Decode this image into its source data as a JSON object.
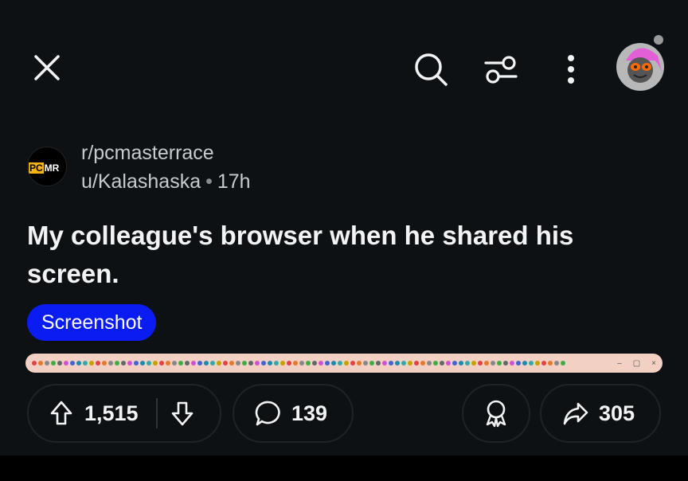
{
  "toolbar": {
    "close_icon": "close-icon",
    "search_icon": "search-icon",
    "filter_icon": "filter-sliders-icon",
    "more_icon": "more-vertical-icon",
    "avatar_icon": "user-avatar"
  },
  "post": {
    "subreddit": "r/pcmasterrace",
    "subreddit_logo_text_a": "PC",
    "subreddit_logo_text_b": "MR",
    "author": "u/Kalashaska",
    "age": "17h",
    "title": "My colleague's browser when he shared his screen.",
    "flair": "Screenshot",
    "flair_color": "#0a1cf2"
  },
  "actions": {
    "upvotes": "1,515",
    "comments": "139",
    "shares": "305"
  },
  "colors": {
    "background": "#0e1113",
    "text": "#f2f3f5",
    "muted": "#c8cbcd",
    "pill_border": "#1f2326",
    "preview_bg": "#f3d0c4"
  }
}
